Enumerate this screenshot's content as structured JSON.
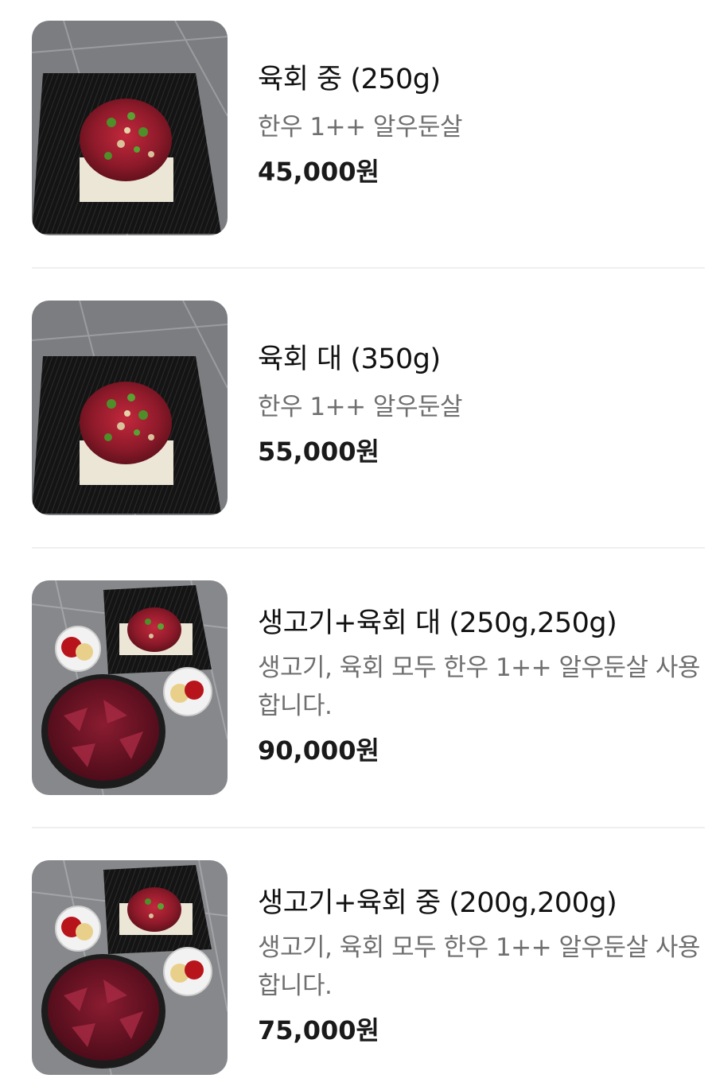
{
  "menu": {
    "items": [
      {
        "name": "육회 중 (250g)",
        "description": "한우 1++ 알우둔살",
        "price": "45,000원",
        "image": "yukhoe-plate"
      },
      {
        "name": "육회 대 (350g)",
        "description": "한우 1++ 알우둔살",
        "price": "55,000원",
        "image": "yukhoe-plate"
      },
      {
        "name": "생고기+육회 대 (250g,250g)",
        "description": "생고기, 육회 모두 한우 1++ 알우둔살 사용 합니다.",
        "price": "90,000원",
        "image": "raw-beef-set"
      },
      {
        "name": "생고기+육회 중 (200g,200g)",
        "description": "생고기, 육회 모두 한우 1++ 알우둔살 사용 합니다.",
        "price": "75,000원",
        "image": "raw-beef-set"
      }
    ]
  },
  "colors": {
    "price": "#1a1a1a",
    "description": "#6f6f6f",
    "divider": "#efefef"
  }
}
